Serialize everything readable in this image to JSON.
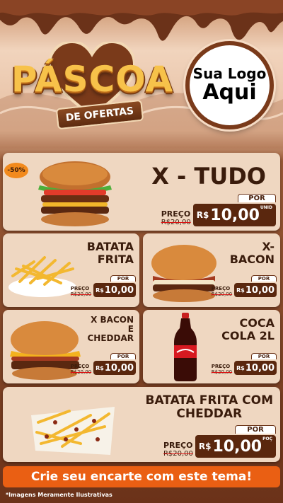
{
  "header": {
    "title": "PÁSCOA",
    "subtitle": "DE OFERTAS",
    "logo_line1": "Sua Logo",
    "logo_line2": "Aqui"
  },
  "badge": "-50%",
  "products": [
    {
      "name": "X - TUDO",
      "preco_label": "PREÇO",
      "old_price": "R$20,00",
      "por_label": "POR",
      "currency": "R$",
      "price": "10,00",
      "unit": "UNID"
    },
    {
      "name_lines": [
        "BATATA",
        "FRITA"
      ],
      "preco_label": "PREÇO",
      "old_price": "R$20,00",
      "por_label": "POR",
      "currency": "R$",
      "price": "10,00"
    },
    {
      "name_lines": [
        "X-",
        "BACON"
      ],
      "preco_label": "PREÇO",
      "old_price": "R$20,00",
      "por_label": "POR",
      "currency": "R$",
      "price": "10,00"
    },
    {
      "name_lines": [
        "X BACON",
        "E",
        "CHEDDAR"
      ],
      "preco_label": "PREÇO",
      "old_price": "R$20,00",
      "por_label": "POR",
      "currency": "R$",
      "price": "10,00"
    },
    {
      "name_lines": [
        "COCA",
        "COLA 2L"
      ],
      "preco_label": "PREÇO",
      "old_price": "R$20,00",
      "por_label": "POR",
      "currency": "R$",
      "price": "10,00"
    },
    {
      "name_lines": [
        "BATATA FRITA COM",
        "CHEDDAR"
      ],
      "preco_label": "PREÇO",
      "old_price": "R$20,00",
      "por_label": "POR",
      "currency": "R$",
      "price": "10,00",
      "unit": "POÇ"
    }
  ],
  "cta": "Crie seu encarte com este tema!",
  "disclaimer": "*Imagens Meramente Ilustrativas",
  "colors": {
    "card_bg": "#efd7c1",
    "price_bg": "#5a270e",
    "cta_bg": "#ea5f13",
    "title_gold": "#f7c24a",
    "chocolate": "#6b3219"
  }
}
